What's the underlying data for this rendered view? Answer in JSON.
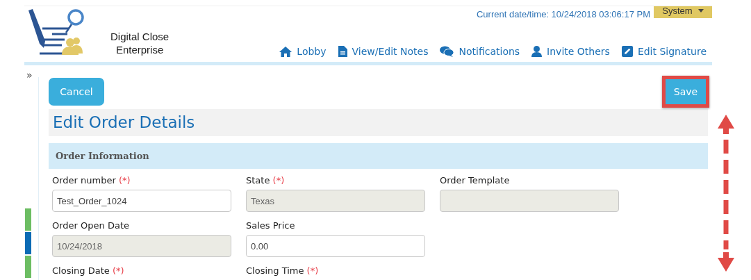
{
  "header": {
    "brand_line1": "Digital Close",
    "brand_line2": "Enterprise",
    "datetime": "Current date/time: 10/24/2018 03:06:17 PM",
    "user_menu": "System",
    "nav": [
      {
        "kind": "home",
        "label": "Lobby"
      },
      {
        "kind": "file",
        "label": "View/Edit Notes"
      },
      {
        "kind": "chat",
        "label": "Notifications"
      },
      {
        "kind": "user",
        "label": "Invite Others"
      },
      {
        "kind": "edit",
        "label": "Edit Signature"
      }
    ]
  },
  "sidebar": {
    "toggle": "»",
    "bars": [
      {
        "color": "#6cbd63"
      },
      {
        "color": "#0b6bb5"
      },
      {
        "color": "#6cbd63"
      }
    ]
  },
  "actions": {
    "cancel": "Cancel",
    "save": "Save",
    "save_highlighted": true
  },
  "page_title": "Edit Order Details",
  "section": "Order Information",
  "required_mark": "(*)",
  "rows": [
    [
      {
        "kind": "input",
        "label": "Order number",
        "required": true,
        "value": "Test_Order_1024",
        "disabled": false
      },
      {
        "kind": "input",
        "label": "State",
        "required": true,
        "value": "Texas",
        "disabled": true
      },
      {
        "kind": "input",
        "label": "Order Template",
        "required": false,
        "disabled": true
      }
    ],
    [
      {
        "kind": "input",
        "label": "Order Open Date",
        "required": false,
        "value": "10/24/2018",
        "disabled": true
      },
      {
        "kind": "input",
        "label": "Sales Price",
        "required": false,
        "value": "0.00",
        "disabled": false
      }
    ],
    [
      {
        "kind": "label_only",
        "label": "Closing Date",
        "required": true
      },
      {
        "kind": "label_only",
        "label": "Closing Time",
        "required": true
      }
    ]
  ]
}
